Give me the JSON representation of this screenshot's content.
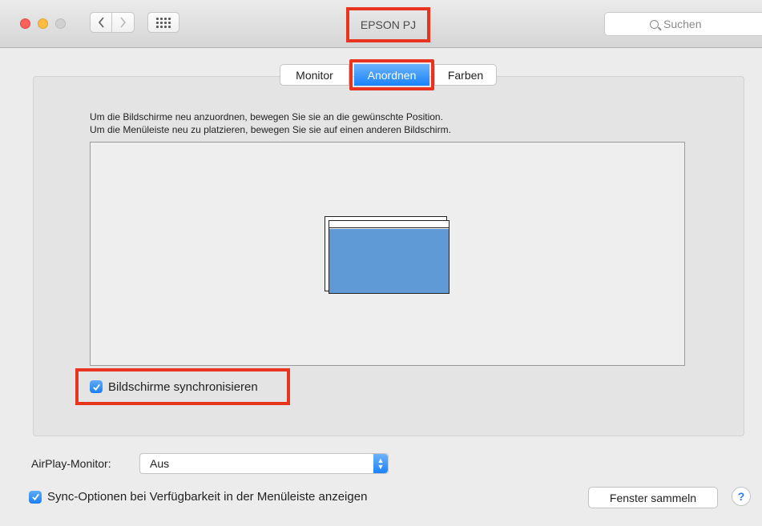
{
  "window": {
    "title": "EPSON PJ",
    "search_placeholder": "Suchen"
  },
  "tabs": [
    {
      "label": "Monitor"
    },
    {
      "label": "Anordnen",
      "selected": true
    },
    {
      "label": "Farben"
    }
  ],
  "arrange": {
    "instruction_1": "Um die Bildschirme neu anzuordnen, bewegen Sie sie an die gewünschte Position.",
    "instruction_2": "Um die Menüleiste neu zu platzieren, bewegen Sie sie auf einen anderen Bildschirm.",
    "mirror_label": "Bildschirme synchronisieren",
    "mirror_checked": true
  },
  "airplay": {
    "label": "AirPlay-Monitor:",
    "value": "Aus"
  },
  "sync": {
    "label": "Sync-Optionen bei Verfügbarkeit in der Menüleiste anzeigen",
    "checked": true
  },
  "buttons": {
    "gather": "Fenster sammeln",
    "help": "?"
  },
  "colors": {
    "accent": "#1a82fb",
    "highlight": "#e8331e",
    "display": "#5f9ad6"
  }
}
